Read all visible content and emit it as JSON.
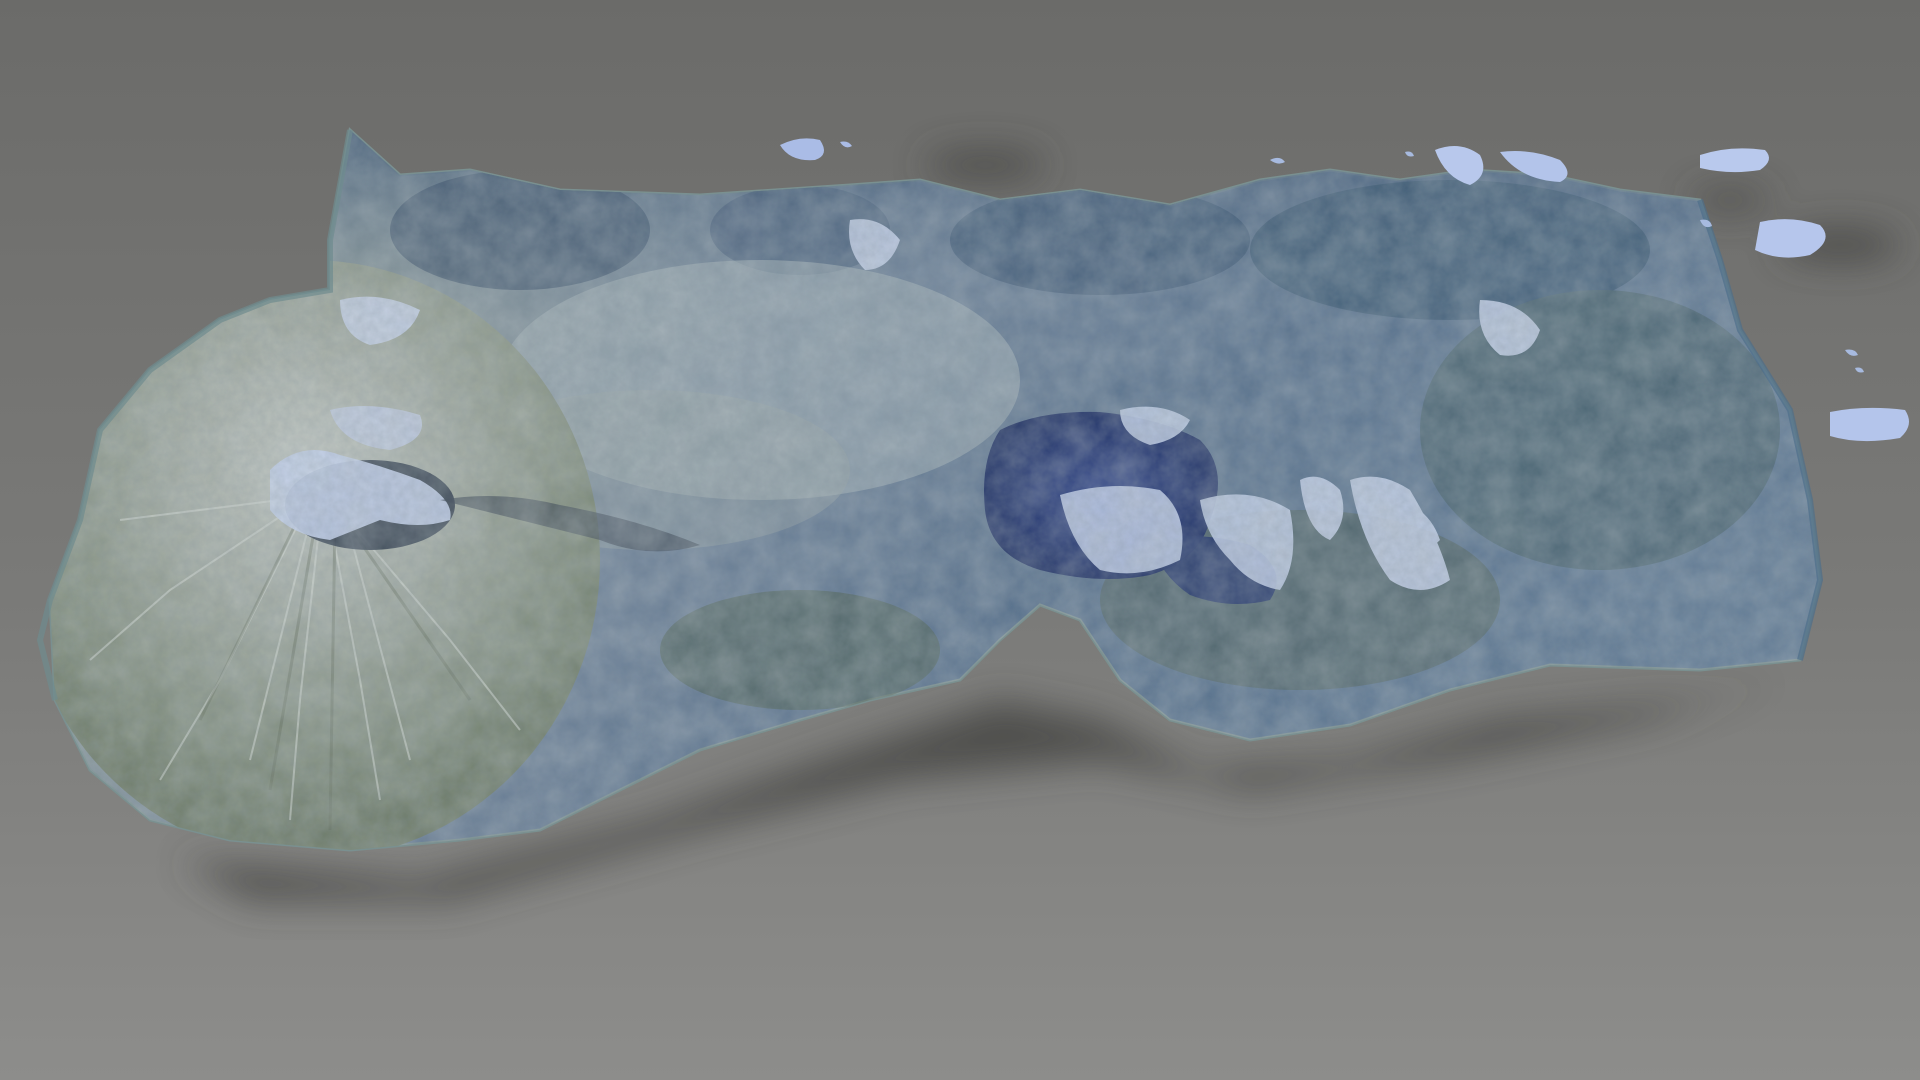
{
  "scene": {
    "subject": "3d-terrain-model",
    "colors": {
      "background_top": "#6b6b69",
      "background_mid": "#787876",
      "background_bottom": "#8c8c8a",
      "shadow": "#3e3e3d",
      "terrain_dark": "#2f4660",
      "terrain_mid": "#5f7690",
      "terrain_light": "#9fb0b8",
      "vegetation": "#5a6a4e",
      "ash": "#b8bcb4",
      "lake": "#1a2f6a",
      "snow": "#c8d6ef",
      "cloud_blue": "#a9bde6"
    }
  }
}
